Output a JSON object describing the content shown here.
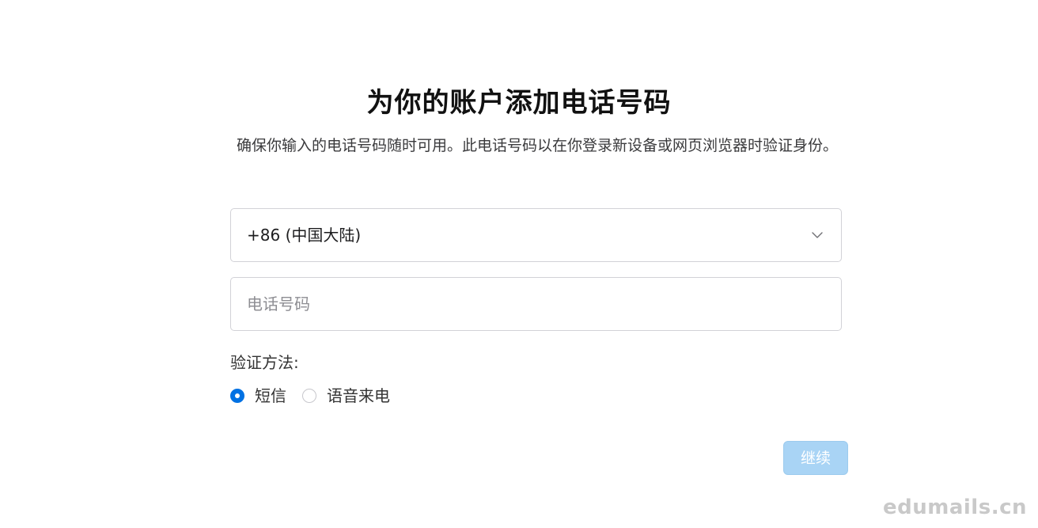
{
  "page": {
    "title": "为你的账户添加电话号码",
    "subtitle": "确保你输入的电话号码随时可用。此电话号码以在你登录新设备或网页浏览器时验证身份。"
  },
  "form": {
    "country_select": {
      "selected_value": "+86 (中国大陆)",
      "icon": "chevron-down-icon"
    },
    "phone_input": {
      "value": "",
      "placeholder": "电话号码"
    },
    "verification": {
      "label": "验证方法:",
      "options": [
        {
          "label": "短信",
          "checked": true
        },
        {
          "label": "语音来电",
          "checked": false
        }
      ]
    },
    "continue_label": "继续"
  },
  "colors": {
    "accent": "#0071e3",
    "button_disabled_bg": "#a9d4f5",
    "border": "#d2d2d7"
  },
  "watermark": "edumails.cn"
}
